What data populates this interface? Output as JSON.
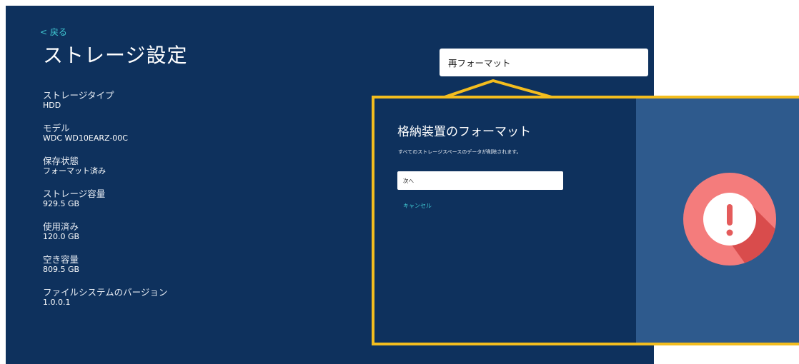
{
  "header": {
    "back_label": "< 戻る",
    "title": "ストレージ設定"
  },
  "info": [
    {
      "label": "ストレージタイプ",
      "value": "HDD"
    },
    {
      "label": "モデル",
      "value": "WDC WD10EARZ-00C"
    },
    {
      "label": "保存状態",
      "value": "フォーマット済み"
    },
    {
      "label": "ストレージ容量",
      "value": "929.5 GB"
    },
    {
      "label": "使用済み",
      "value": "120.0 GB"
    },
    {
      "label": "空き容量",
      "value": "809.5 GB"
    },
    {
      "label": "ファイルシステムのバージョン",
      "value": "1.0.0.1"
    }
  ],
  "reformat_button": {
    "label": "再フォーマット"
  },
  "dialog": {
    "title": "格納装置のフォーマット",
    "description": "すべてのストレージスペースのデータが削除されます。",
    "next_label": "次へ",
    "cancel_label": "キャンセル",
    "icon": "warning-exclamation-icon"
  },
  "colors": {
    "background": "#0e315d",
    "accent": "#40c8d2",
    "callout_border": "#f3bd1e",
    "dialog_side": "#2e5a8d",
    "warning_circle": "#f47c7c"
  }
}
